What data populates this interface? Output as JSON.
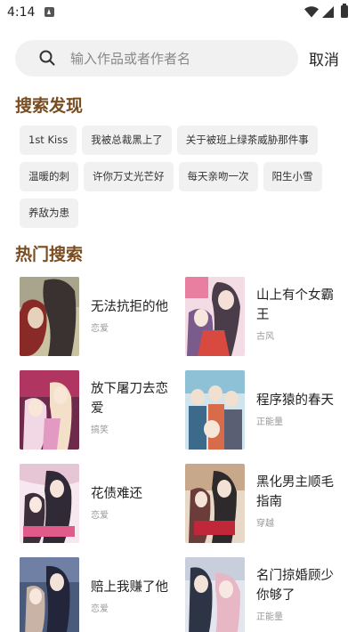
{
  "status": {
    "time": "4:14"
  },
  "search": {
    "placeholder": "输入作品或者作者名",
    "value": "",
    "cancel_label": "取消"
  },
  "discover": {
    "title": "搜索发现",
    "rows": [
      [
        "1st Kiss",
        "我被总裁黑上了",
        "关于被班上绿茶威胁那件事"
      ],
      [
        "温暖的刺",
        "许你万丈光芒好",
        "每天亲吻一次",
        "阳生小雪"
      ],
      [
        "养敌为患"
      ]
    ]
  },
  "hot": {
    "title": "热门搜索",
    "items": [
      {
        "title": "无法抗拒的他",
        "genre": "恋爱"
      },
      {
        "title": "山上有个女霸王",
        "genre": "古风"
      },
      {
        "title": "放下屠刀去恋爱",
        "genre": "搞笑"
      },
      {
        "title": "程序猿的春天",
        "genre": "正能量"
      },
      {
        "title": "花债难还",
        "genre": "恋爱"
      },
      {
        "title": "黑化男主顺毛指南",
        "genre": "穿越"
      },
      {
        "title": "赔上我赚了他",
        "genre": "恋爱"
      },
      {
        "title": "名门掠婚顾少你够了",
        "genre": "正能量"
      }
    ]
  },
  "colors": {
    "section_title": "#7a4d20",
    "tag_bg": "#f1f1f1",
    "search_bg": "#f1f1f1"
  },
  "icons": [
    "search-icon",
    "wifi-icon",
    "signal-icon",
    "battery-icon"
  ]
}
